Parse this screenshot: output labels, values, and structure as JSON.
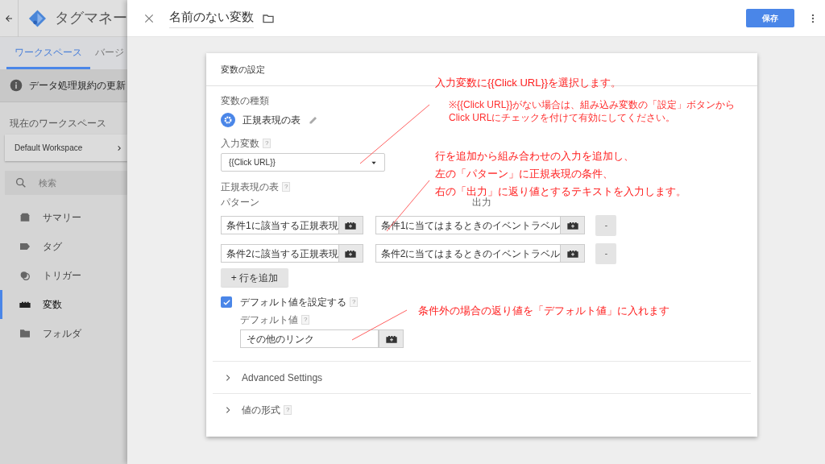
{
  "app": {
    "title": "タグマネー",
    "tabs": [
      {
        "label": "ワークスペース",
        "selected": true
      },
      {
        "label": "バージ",
        "selected": false
      }
    ],
    "notice": "データ処理規約の更新",
    "workspace_label": "現在のワークスペース",
    "workspace": "Default Workspace",
    "search_placeholder": "検索",
    "nav": [
      {
        "label": "サマリー",
        "kind": "summary",
        "selected": false
      },
      {
        "label": "タグ",
        "kind": "tag",
        "selected": false
      },
      {
        "label": "トリガー",
        "kind": "trigger",
        "selected": false
      },
      {
        "label": "変数",
        "kind": "variable",
        "selected": true
      },
      {
        "label": "フォルダ",
        "kind": "folder",
        "selected": false
      }
    ]
  },
  "panel": {
    "title": "名前のない変数",
    "save": "保存"
  },
  "card": {
    "heading": "変数の設定",
    "type_label": "変数の種類",
    "type": "正規表現の表",
    "input_label": "入力変数",
    "input_help": "?",
    "input_value": "{{Click URL}}",
    "table_label": "正規表現の表",
    "table_help": "?",
    "columns": [
      "パターン",
      "出力"
    ],
    "rows": [
      {
        "pattern": "条件1に該当する正規表現",
        "output": "条件1に当てはまるときのイベントラベル",
        "remove": "-"
      },
      {
        "pattern": "条件2に該当する正規表現",
        "output": "条件2に当てはまるときのイベントラベル",
        "remove": "-"
      }
    ],
    "add_row": "+ 行を追加",
    "default_checkbox": {
      "label": "デフォルト値を設定する",
      "help": "?",
      "checked": true
    },
    "default_label": "デフォルト値",
    "default_help": "?",
    "default_value": "その他のリンク",
    "sections": [
      {
        "label": "Advanced Settings"
      },
      {
        "label": "値の形式",
        "help": "?"
      }
    ]
  },
  "annotations": [
    {
      "kind": "title",
      "lines": [
        "入力変数に{{Click URL}}を選択します。"
      ]
    },
    {
      "kind": "note",
      "lines": [
        "※{{Click URL}}がない場合は、組み込み変数の「設定」ボタンから",
        "Click URLにチェックを付けて有効にしてください。"
      ]
    },
    {
      "kind": "title",
      "lines": [
        "行を追加から組み合わせの入力を追加し、",
        "左の「パターン」に正規表現の条件、",
        "右の「出力」に返り値とするテキストを入力します。"
      ]
    },
    {
      "kind": "title",
      "lines": [
        "条件外の場合の返り値を「デフォルト値」に入れます"
      ]
    }
  ]
}
